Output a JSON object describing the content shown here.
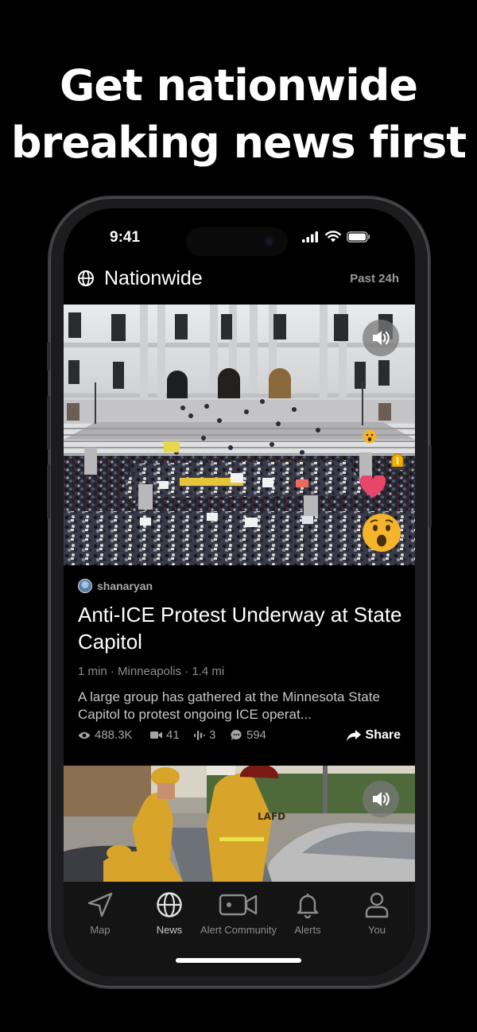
{
  "promo": {
    "headline_line1": "Get nationwide",
    "headline_line2": "breaking news first"
  },
  "status_bar": {
    "time": "9:41",
    "icons": [
      "cellular-signal-icon",
      "wifi-icon",
      "battery-icon"
    ]
  },
  "header": {
    "icon": "globe-icon",
    "title": "Nationwide",
    "time_filter": "Past 24h"
  },
  "feed": {
    "items": [
      {
        "media_type": "video",
        "media_scene": "crowd protest at state capitol steps",
        "sound_icon": "speaker-icon",
        "reactions": [
          "astonished-face-emoji",
          "siren-emoji",
          "heart-emoji",
          "astonished-face-emoji"
        ],
        "author": "shanaryan",
        "title": "Anti-ICE Protest Underway at State Capitol",
        "meta": "1 min · Minneapolis · 1.4 mi",
        "summary": "A large group has gathered at the Minnesota State Capitol to protest ongoing ICE operat...",
        "stats": {
          "views": "488.3K",
          "videos": "41",
          "listeners": "3",
          "comments": "594"
        },
        "share_label": "Share"
      },
      {
        "media_type": "video",
        "media_scene": "firefighters at car crash",
        "sound_icon": "speaker-icon",
        "helmet_text": "LAFD"
      }
    ]
  },
  "tab_bar": {
    "tabs": [
      {
        "label": "Map",
        "icon": "location-arrow-icon",
        "active": false
      },
      {
        "label": "News",
        "icon": "globe-icon",
        "active": true
      },
      {
        "label": "Alert Community",
        "icon": "video-camera-icon",
        "active": false
      },
      {
        "label": "Alerts",
        "icon": "bell-icon",
        "active": false
      },
      {
        "label": "You",
        "icon": "person-icon",
        "active": false
      }
    ]
  },
  "colors": {
    "background": "#000000",
    "tab_bar": "#141414",
    "secondary_text": "#8e8e8e",
    "heart": "#e8456b",
    "firefighter_yellow": "#d8a42a"
  }
}
